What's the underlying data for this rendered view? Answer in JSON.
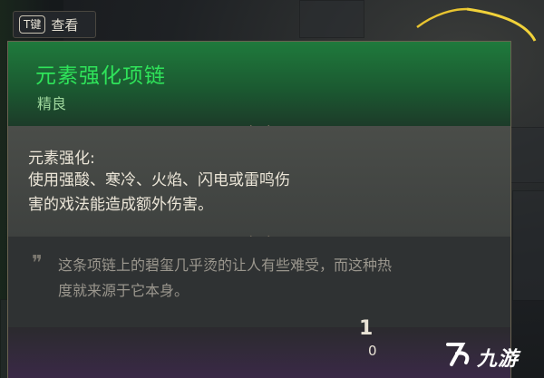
{
  "hotkey": {
    "key": "T键",
    "label": "查看"
  },
  "item": {
    "name": "元素强化项链",
    "rarity": "精良",
    "effect_title": "元素强化:",
    "effect_lines": [
      "使用强酸、寒冷、火焰、闪电或雷鸣伤",
      "害的戏法能造成额外伤害。"
    ],
    "flavor_lines": [
      "这条项链上的碧玺几乎烫的让人有些难受，而这种热",
      "度就来源于它本身。"
    ]
  },
  "partial_glyphs": {
    "top": "1",
    "bottom": "0"
  },
  "watermark": {
    "text": "九游"
  },
  "colors": {
    "title": "#2fe35a",
    "rarity": "#9fd79d",
    "header": "#1f7a3c"
  }
}
